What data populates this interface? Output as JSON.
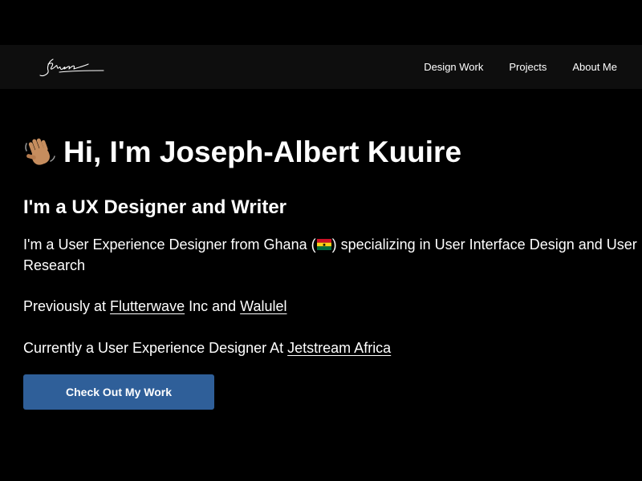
{
  "nav": {
    "logo_icon": "signature-logo",
    "links": [
      {
        "label": "Design Work"
      },
      {
        "label": "Projects"
      },
      {
        "label": "About Me"
      }
    ]
  },
  "hero": {
    "greeting_icon": "waving-hand-emoji",
    "title": "Hi, I'm Joseph-Albert Kuuire",
    "subtitle": "I'm a UX Designer and Writer",
    "intro_before_flag": "I'm a User Experience Designer from Ghana (",
    "flag_icon": "ghana-flag-emoji",
    "intro_after_flag": ") specializing in User Interface Design and User Research",
    "previously_prefix": "Previously at ",
    "previously_link_1": "Flutterwave",
    "previously_middle": " Inc and ",
    "previously_link_2": "Walulel",
    "current_prefix": "Currently a User Experience Designer At ",
    "current_link": "Jetstream Africa",
    "cta_label": "Check Out My Work"
  },
  "colors": {
    "background": "#000000",
    "navbar": "#0e0e0e",
    "text": "#ffffff",
    "button": "#2f5f99"
  }
}
